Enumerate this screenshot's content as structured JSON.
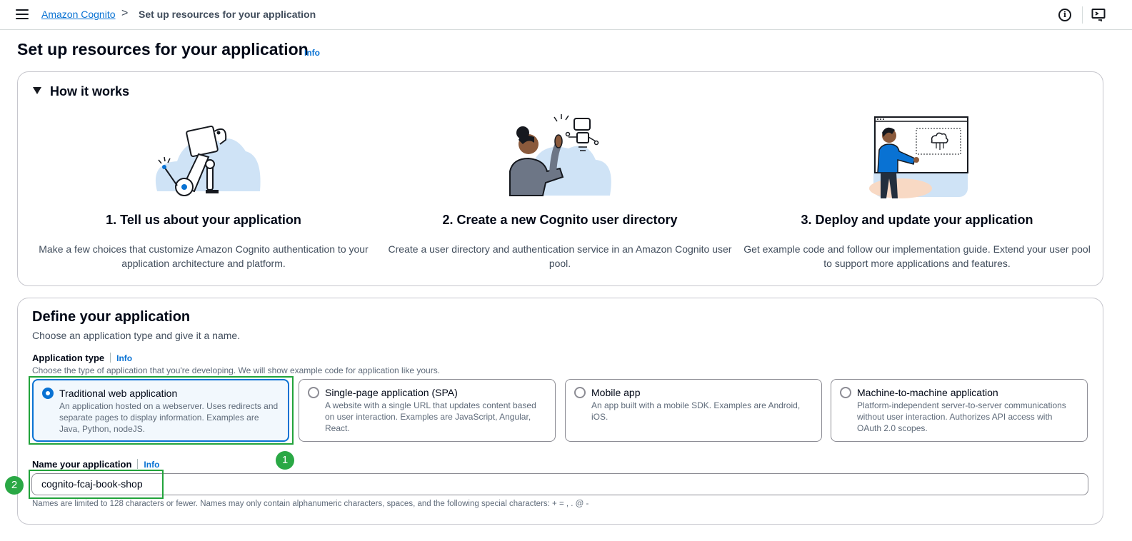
{
  "breadcrumb": {
    "root": "Amazon Cognito",
    "separator": ">",
    "current": "Set up resources for your application"
  },
  "page": {
    "title": "Set up resources for your application",
    "info": "Info"
  },
  "how_it_works": {
    "title": "How it works",
    "steps": [
      {
        "title": "1. Tell us about your application",
        "description": "Make a few choices that customize Amazon Cognito authentication to your application architecture and platform."
      },
      {
        "title": "2. Create a new Cognito user directory",
        "description": "Create a user directory and authentication service in an Amazon Cognito user pool."
      },
      {
        "title": "3. Deploy and update your application",
        "description": "Get example code and follow our implementation guide. Extend your user pool to support more applications and features."
      }
    ]
  },
  "define": {
    "title": "Define your application",
    "subtitle": "Choose an application type and give it a name.",
    "app_type": {
      "label": "Application type",
      "info": "Info",
      "description": "Choose the type of application that you're developing. We will show example code for application like yours.",
      "options": [
        {
          "title": "Traditional web application",
          "description": "An application hosted on a webserver. Uses redirects and separate pages to display information. Examples are Java, Python, nodeJS.",
          "selected": true
        },
        {
          "title": "Single-page application (SPA)",
          "description": "A website with a single URL that updates content based on user interaction. Examples are JavaScript, Angular, React.",
          "selected": false
        },
        {
          "title": "Mobile app",
          "description": "An app built with a mobile SDK. Examples are Android, iOS.",
          "selected": false
        },
        {
          "title": "Machine-to-machine application",
          "description": "Platform-independent server-to-server communications without user interaction. Authorizes API access with OAuth 2.0 scopes.",
          "selected": false
        }
      ]
    },
    "name": {
      "label": "Name your application",
      "info": "Info",
      "value": "cognito-fcaj-book-shop",
      "constraint": "Names are limited to 128 characters or fewer. Names may only contain alphanumeric characters, spaces, and the following special characters: + = , . @ -"
    }
  },
  "annotations": {
    "badge_1": "1",
    "badge_2": "2"
  },
  "colors": {
    "link": "#0972d3",
    "selected_border": "#0972d3",
    "selected_bg": "#f2f8fd",
    "annotation_green": "#2aa845"
  }
}
